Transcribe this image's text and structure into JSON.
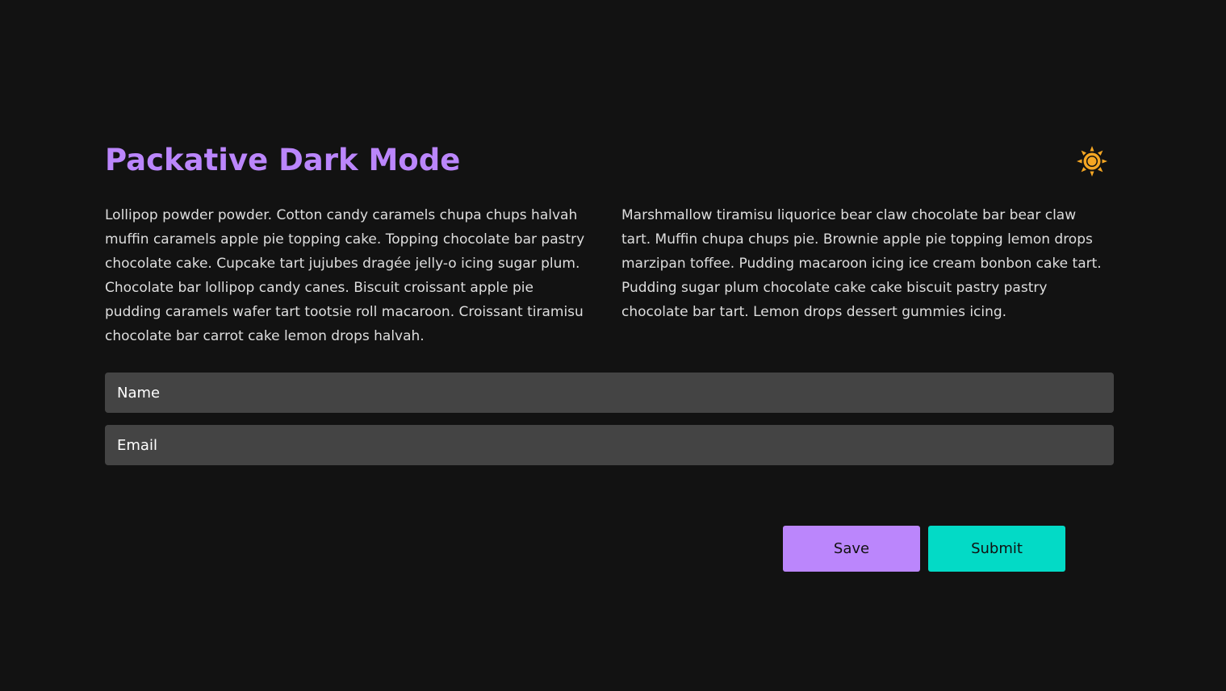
{
  "page": {
    "title": "Packative Dark Mode",
    "theme_toggle_icon": "sun-icon"
  },
  "content": {
    "paragraph_left": "Lollipop powder powder. Cotton candy caramels chupa chups halvah muffin caramels apple pie topping cake. Topping chocolate bar pastry chocolate cake. Cupcake tart jujubes dragée jelly-o icing sugar plum. Chocolate bar lollipop candy canes. Biscuit croissant apple pie pudding caramels wafer tart tootsie roll macaroon. Croissant tiramisu chocolate bar carrot cake lemon drops halvah.",
    "paragraph_right": "Marshmallow tiramisu liquorice bear claw chocolate bar bear claw tart. Muffin chupa chups pie. Brownie apple pie topping lemon drops marzipan toffee. Pudding macaroon icing ice cream bonbon cake tart. Pudding sugar plum chocolate cake cake biscuit pastry pastry chocolate bar tart. Lemon drops dessert gummies icing."
  },
  "form": {
    "name_placeholder": "Name",
    "name_value": "",
    "email_placeholder": "Email",
    "email_value": ""
  },
  "actions": {
    "save_label": "Save",
    "submit_label": "Submit"
  },
  "colors": {
    "background": "#121212",
    "accent_primary": "#bb86fc",
    "accent_secondary": "#03dac6",
    "input_background": "#444444",
    "text": "#dedede",
    "sun": "#f5a623"
  }
}
